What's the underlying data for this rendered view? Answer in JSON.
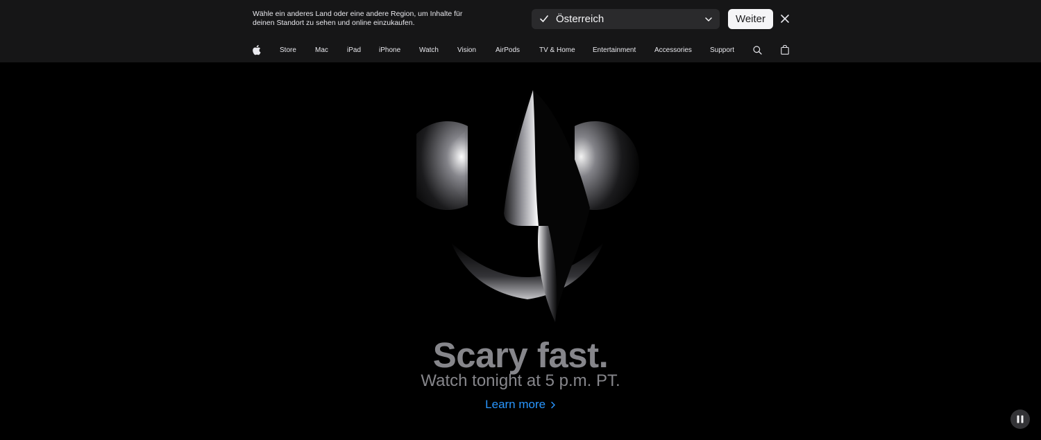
{
  "locale_banner": {
    "message": "Wähle ein anderes Land oder eine andere Region, um Inhalte für deinen Standort zu sehen und online einzukaufen.",
    "selected_region": "Österreich",
    "continue_label": "Weiter",
    "icons": {
      "check": "checkmark-icon",
      "dropdown": "chevron-down-icon",
      "close": "close-icon"
    }
  },
  "nav": {
    "logo_icon": "apple-logo-icon",
    "items": [
      "Store",
      "Mac",
      "iPad",
      "iPhone",
      "Watch",
      "Vision",
      "AirPods",
      "TV & Home",
      "Entertainment",
      "Accessories",
      "Support"
    ],
    "search_icon": "search-icon",
    "bag_icon": "shopping-bag-icon"
  },
  "hero": {
    "headline": "Scary fast.",
    "subhead": "Watch tonight at 5 p.m. PT.",
    "link_label": "Learn more",
    "link_icon": "chevron-right-icon",
    "artwork_icon": "finder-face-icon",
    "pause_icon": "pause-icon"
  },
  "colors": {
    "background": "#000000",
    "nav_background": "#161617",
    "headline": "#86868b",
    "link": "#2997ff"
  }
}
